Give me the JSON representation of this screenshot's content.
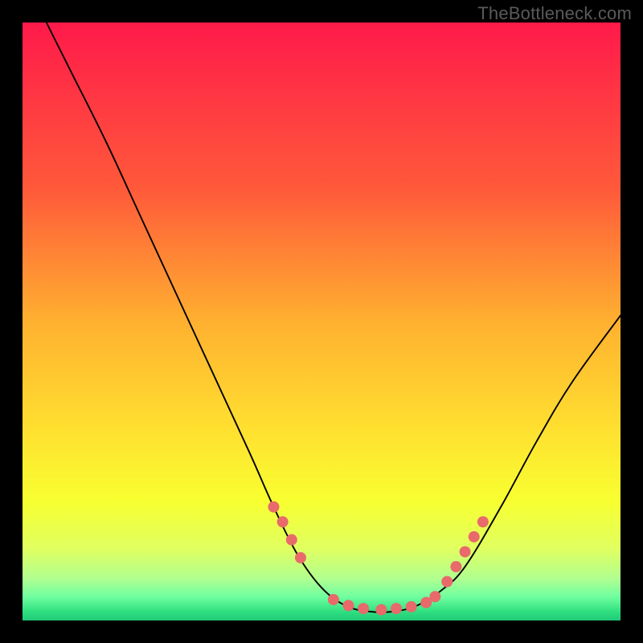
{
  "watermark": "TheBottleneck.com",
  "chart_data": {
    "type": "line",
    "title": "",
    "xlabel": "",
    "ylabel": "",
    "xlim": [
      0,
      100
    ],
    "ylim": [
      0,
      100
    ],
    "gradient_stops": [
      {
        "offset": 0,
        "color": "#ff1a4a"
      },
      {
        "offset": 0.28,
        "color": "#ff5a3a"
      },
      {
        "offset": 0.5,
        "color": "#ffb030"
      },
      {
        "offset": 0.68,
        "color": "#ffe030"
      },
      {
        "offset": 0.8,
        "color": "#f8ff30"
      },
      {
        "offset": 0.88,
        "color": "#e0ff60"
      },
      {
        "offset": 0.93,
        "color": "#b0ff90"
      },
      {
        "offset": 0.96,
        "color": "#70ffa0"
      },
      {
        "offset": 0.985,
        "color": "#30e080"
      },
      {
        "offset": 1.0,
        "color": "#20c878"
      }
    ],
    "curve": [
      {
        "x": 4,
        "y": 100
      },
      {
        "x": 8,
        "y": 92
      },
      {
        "x": 14,
        "y": 80
      },
      {
        "x": 20,
        "y": 67
      },
      {
        "x": 26,
        "y": 54
      },
      {
        "x": 32,
        "y": 41
      },
      {
        "x": 38,
        "y": 28
      },
      {
        "x": 42,
        "y": 19
      },
      {
        "x": 46,
        "y": 11
      },
      {
        "x": 50,
        "y": 5.5
      },
      {
        "x": 54,
        "y": 2.5
      },
      {
        "x": 58,
        "y": 1.5
      },
      {
        "x": 62,
        "y": 1.5
      },
      {
        "x": 66,
        "y": 2.5
      },
      {
        "x": 70,
        "y": 5
      },
      {
        "x": 74,
        "y": 9
      },
      {
        "x": 80,
        "y": 19
      },
      {
        "x": 86,
        "y": 30
      },
      {
        "x": 92,
        "y": 40
      },
      {
        "x": 100,
        "y": 51
      }
    ],
    "markers": [
      {
        "x": 42,
        "y": 19
      },
      {
        "x": 43.5,
        "y": 16.5
      },
      {
        "x": 45,
        "y": 13.5
      },
      {
        "x": 46.5,
        "y": 10.5
      },
      {
        "x": 52,
        "y": 3.5
      },
      {
        "x": 54.5,
        "y": 2.5
      },
      {
        "x": 57,
        "y": 2
      },
      {
        "x": 60,
        "y": 1.8
      },
      {
        "x": 62.5,
        "y": 2
      },
      {
        "x": 65,
        "y": 2.3
      },
      {
        "x": 67.5,
        "y": 3
      },
      {
        "x": 69,
        "y": 4
      },
      {
        "x": 71,
        "y": 6.5
      },
      {
        "x": 72.5,
        "y": 9
      },
      {
        "x": 74,
        "y": 11.5
      },
      {
        "x": 75.5,
        "y": 14
      },
      {
        "x": 77,
        "y": 16.5
      }
    ],
    "marker_color": "#e86a6a",
    "marker_radius": 7
  }
}
